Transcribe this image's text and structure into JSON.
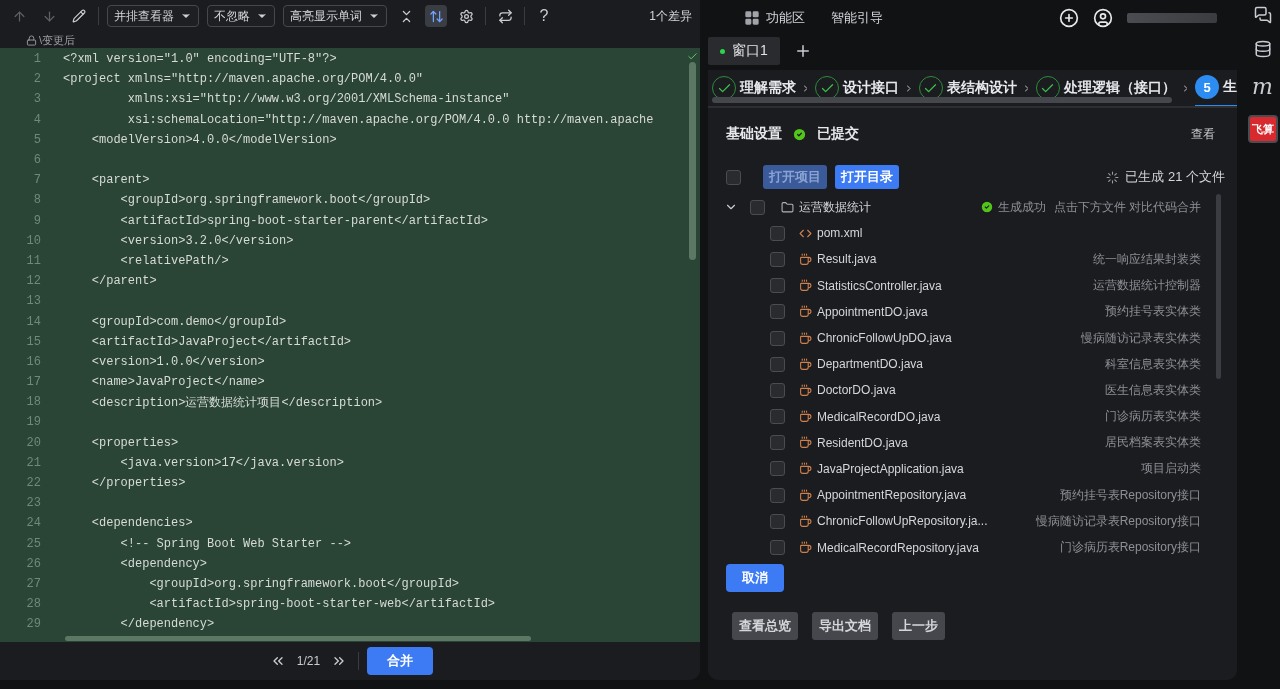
{
  "diff_toolbar": {
    "dropdowns": [
      "并排查看器",
      "不忽略",
      "高亮显示单词"
    ],
    "sync_scroll_on": true,
    "help": "?",
    "diff_count": "1个差异"
  },
  "file_caption": "\\变更后",
  "code_lines": [
    {
      "number": "1",
      "text": "<?xml version=\"1.0\" encoding=\"UTF-8\"?>"
    },
    {
      "number": "2",
      "text": "<project xmlns=\"http://maven.apache.org/POM/4.0.0\""
    },
    {
      "number": "3",
      "text": "         xmlns:xsi=\"http://www.w3.org/2001/XMLSchema-instance\""
    },
    {
      "number": "4",
      "text": "         xsi:schemaLocation=\"http://maven.apache.org/POM/4.0.0 http://maven.apache"
    },
    {
      "number": "5",
      "text": "    <modelVersion>4.0.0</modelVersion>"
    },
    {
      "number": "6"
    },
    {
      "number": "7",
      "text": "    <parent>"
    },
    {
      "number": "8",
      "text": "        <groupId>org.springframework.boot</groupId>"
    },
    {
      "number": "9",
      "text": "        <artifactId>spring-boot-starter-parent</artifactId>"
    },
    {
      "number": "10",
      "text": "        <version>3.2.0</version>"
    },
    {
      "number": "11",
      "text": "        <relativePath/>"
    },
    {
      "number": "12",
      "text": "    </parent>"
    },
    {
      "number": "13"
    },
    {
      "number": "14",
      "text": "    <groupId>com.demo</groupId>"
    },
    {
      "number": "15",
      "text": "    <artifactId>JavaProject</artifactId>"
    },
    {
      "number": "16",
      "text": "    <version>1.0.0</version>"
    },
    {
      "number": "17",
      "text": "    <name>JavaProject</name>"
    },
    {
      "number": "18",
      "text": "    <description>运营数据统计项目</description>"
    },
    {
      "number": "19"
    },
    {
      "number": "20",
      "text": "    <properties>"
    },
    {
      "number": "21",
      "text": "        <java.version>17</java.version>"
    },
    {
      "number": "22",
      "text": "    </properties>"
    },
    {
      "number": "23"
    },
    {
      "number": "24",
      "text": "    <dependencies>"
    },
    {
      "number": "25",
      "text": "        <!-- Spring Boot Web Starter -->"
    },
    {
      "number": "26",
      "text": "        <dependency>"
    },
    {
      "number": "27",
      "text": "            <groupId>org.springframework.boot</groupId>"
    },
    {
      "number": "28",
      "text": "            <artifactId>spring-boot-starter-web</artifactId>"
    },
    {
      "number": "29",
      "text": "        </dependency>"
    }
  ],
  "pager": {
    "position": "1/21",
    "merge_button": "合并"
  },
  "header": {
    "feature_area": "功能区",
    "smart_guide": "智能引导"
  },
  "window_tabs": [
    {
      "label": "窗口1",
      "selected": true
    }
  ],
  "steps": [
    {
      "completed": true,
      "selected": false,
      "label": "理解需求"
    },
    {
      "completed": true,
      "selected": false,
      "label": "设计接口"
    },
    {
      "completed": true,
      "selected": false,
      "label": "表结构设计"
    },
    {
      "completed": true,
      "selected": false,
      "label": "处理逻辑（接口）"
    },
    {
      "completed": false,
      "selected": true,
      "number": "5",
      "label": "生"
    }
  ],
  "basic_settings": {
    "title": "基础设置",
    "status": "已提交",
    "view_link": "查看"
  },
  "file_actions": {
    "all_checked": false,
    "buttons": [
      {
        "label": "打开项目",
        "disabled": true
      },
      {
        "label": "打开目录",
        "disabled": false
      }
    ],
    "generated_count": "已生成 21 个文件"
  },
  "folder": {
    "name": "运营数据统计",
    "expanded": true,
    "checked": false,
    "status": "生成成功",
    "hint": "点击下方文件 对比代码合并",
    "children": [
      {
        "kind": "xml",
        "name": "pom.xml",
        "checked": false
      },
      {
        "kind": "java",
        "name": "Result.java",
        "description": "统一响应结果封装类",
        "checked": false
      },
      {
        "kind": "java",
        "name": "StatisticsController.java",
        "description": "运营数据统计控制器",
        "checked": false
      },
      {
        "kind": "java",
        "name": "AppointmentDO.java",
        "description": "预约挂号表实体类",
        "checked": false
      },
      {
        "kind": "java",
        "name": "ChronicFollowUpDO.java",
        "description": "慢病随访记录表实体类",
        "checked": false
      },
      {
        "kind": "java",
        "name": "DepartmentDO.java",
        "description": "科室信息表实体类",
        "checked": false
      },
      {
        "kind": "java",
        "name": "DoctorDO.java",
        "description": "医生信息表实体类",
        "checked": false
      },
      {
        "kind": "java",
        "name": "MedicalRecordDO.java",
        "description": "门诊病历表实体类",
        "checked": false
      },
      {
        "kind": "java",
        "name": "ResidentDO.java",
        "description": "居民档案表实体类",
        "checked": false
      },
      {
        "kind": "java",
        "name": "JavaProjectApplication.java",
        "description": "项目启动类",
        "checked": false
      },
      {
        "kind": "java",
        "name": "AppointmentRepository.java",
        "description": "预约挂号表Repository接口",
        "checked": false
      },
      {
        "kind": "java",
        "name": "ChronicFollowUpRepository.ja...",
        "description": "慢病随访记录表Repository接口",
        "checked": false
      },
      {
        "kind": "java",
        "name": "MedicalRecordRepository.java",
        "description": "门诊病历表Repository接口",
        "checked": false
      }
    ]
  },
  "cancel_button": "取消",
  "footer_buttons": [
    "查看总览",
    "导出文档",
    "上一步"
  ],
  "side_rail": {
    "letter_logo": "m",
    "brand_badge": "飞算"
  }
}
